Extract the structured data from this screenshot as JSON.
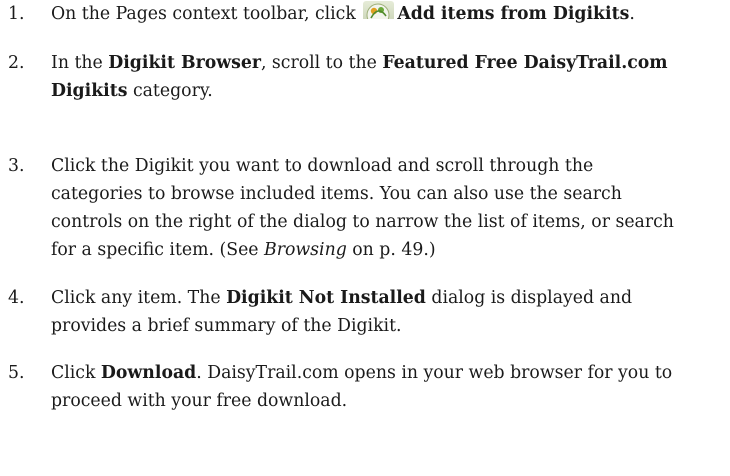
{
  "steps": [
    {
      "number": "1.",
      "segments": [
        {
          "text": "On the Pages context toolbar, click "
        },
        {
          "icon": "add-items-from-digikits-icon"
        },
        {
          "text": "Add items from Digikits",
          "bold": true
        },
        {
          "text": "."
        }
      ]
    },
    {
      "number": "2.",
      "segments": [
        {
          "text": "In the "
        },
        {
          "text": "Digikit Browser",
          "bold": true
        },
        {
          "text": ", scroll to the "
        },
        {
          "text": "Featured Free DaisyTrail.com Digikits",
          "bold": true
        },
        {
          "text": " category."
        }
      ]
    },
    {
      "number": "3.",
      "segments": [
        {
          "text": "Click the Digikit you want to download and scroll through the categories to browse included items. You can also use the search controls on the right of the dialog to narrow the list of items, or search for a specific item. (See "
        },
        {
          "text": "Browsing",
          "italic": true
        },
        {
          "text": " on p. 49.)"
        }
      ]
    },
    {
      "number": "4.",
      "segments": [
        {
          "text": "Click any item. The "
        },
        {
          "text": "Digikit Not Installed",
          "bold": true
        },
        {
          "text": " dialog is displayed and provides a brief summary of the Digikit."
        }
      ]
    },
    {
      "number": "5.",
      "segments": [
        {
          "text": "Click "
        },
        {
          "text": "Download",
          "bold": true
        },
        {
          "text": ". DaisyTrail.com opens in your web browser for you to proceed with your free download."
        }
      ]
    }
  ]
}
